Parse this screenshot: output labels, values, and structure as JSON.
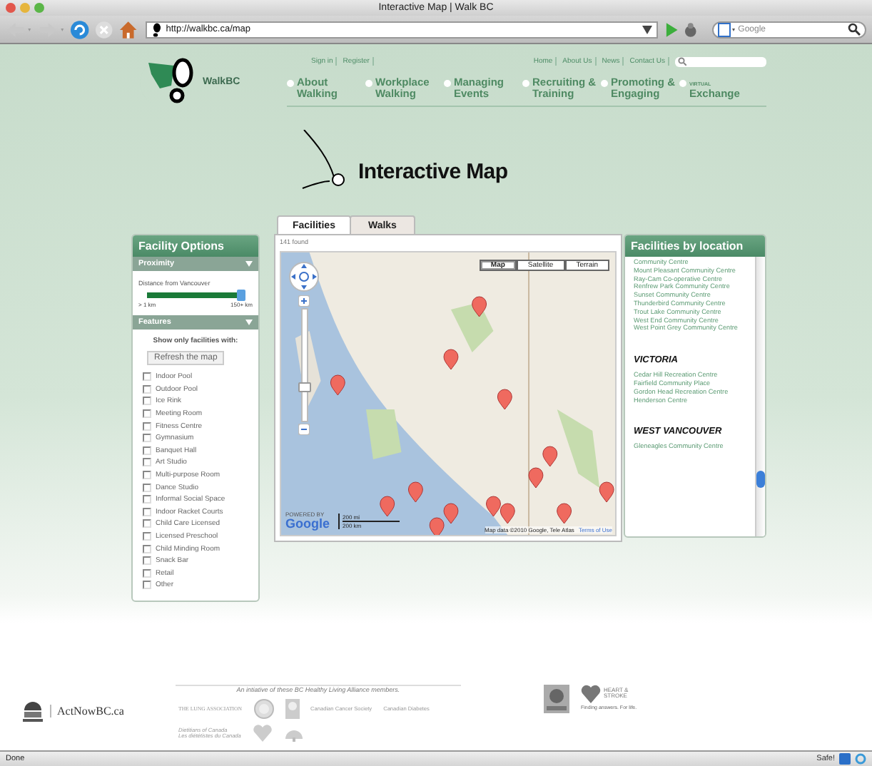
{
  "browser": {
    "title": "Interactive Map | Walk BC",
    "url": "http://walkbc.ca/map",
    "search_placeholder": "Google",
    "status": "Done",
    "safe_label": "Safe!"
  },
  "header": {
    "logo_text": "WalkBC",
    "account_links": [
      "Sign in",
      "Register"
    ],
    "util_links": [
      "Home",
      "About Us",
      "News",
      "Contact Us"
    ],
    "nav": [
      {
        "label": "About Walking"
      },
      {
        "label": "Workplace Walking"
      },
      {
        "label": "Managing Events"
      },
      {
        "label": "Recruiting & Training"
      },
      {
        "label": "Promoting & Engaging"
      },
      {
        "label": "Exchange",
        "tag": "VIRTUAL"
      }
    ],
    "page_title": "Interactive Map"
  },
  "facility_options": {
    "title": "Facility Options",
    "proximity": {
      "heading": "Proximity",
      "expanded": true,
      "label": "Distance from Vancouver",
      "level": 0.97,
      "min": "> 1 km",
      "max": "150+ km"
    },
    "features": {
      "heading": "Features",
      "expanded": true,
      "intro": "Show only facilities with:",
      "button": "Refresh the map",
      "items": [
        {
          "label": "Indoor Pool",
          "checked": false
        },
        {
          "label": "Outdoor Pool",
          "checked": false
        },
        {
          "label": "Ice Rink",
          "checked": false
        },
        {
          "label": "Meeting Room",
          "checked": false
        },
        {
          "label": "Fitness Centre",
          "checked": false
        },
        {
          "label": "Gymnasium",
          "checked": false
        },
        {
          "label": "Banquet Hall",
          "checked": false
        },
        {
          "label": "Art Studio",
          "checked": false
        },
        {
          "label": "Multi-purpose Room",
          "checked": false
        },
        {
          "label": "Dance Studio",
          "checked": false
        },
        {
          "label": "Informal Social Space",
          "checked": false
        },
        {
          "label": "Indoor Racket Courts",
          "checked": false
        },
        {
          "label": "Child Care Licensed",
          "checked": false
        },
        {
          "label": "Licensed Preschool",
          "checked": false
        },
        {
          "label": "Child Minding Room",
          "checked": false
        },
        {
          "label": "Snack Bar",
          "checked": false
        },
        {
          "label": "Retail",
          "checked": false
        },
        {
          "label": "Other",
          "checked": false
        }
      ]
    }
  },
  "tabs": [
    {
      "label": "Facilities",
      "selected": true
    },
    {
      "label": "Walks",
      "selected": false
    }
  ],
  "found": "141 found",
  "map": {
    "kind": "picture",
    "types": [
      {
        "label": "Map",
        "selected": true
      },
      {
        "label": "Satellite",
        "selected": false
      },
      {
        "label": "Terrain",
        "selected": false
      }
    ],
    "zoom": {
      "level": 0.3
    },
    "powered": "POWERED BY",
    "google": "Google",
    "scale": [
      "200 mi",
      "200 km"
    ],
    "attribution": "Map data ©2010 Google, Tele Atlas",
    "terms": "Terms of Use"
  },
  "locations": {
    "title": "Facilities by location",
    "items": [
      {
        "kind": "entry",
        "label": "Community Centre"
      },
      {
        "kind": "entry",
        "label": "Mount Pleasant Community Centre"
      },
      {
        "kind": "entry",
        "label": "Ray-Cam Co-operative Centre"
      },
      {
        "kind": "entry",
        "label": "Renfrew Park Community Centre"
      },
      {
        "kind": "entry",
        "label": "Sunset Community Centre"
      },
      {
        "kind": "entry",
        "label": "Thunderbird Community Centre"
      },
      {
        "kind": "entry",
        "label": "Trout Lake Community Centre"
      },
      {
        "kind": "entry",
        "label": "West End Community Centre"
      },
      {
        "kind": "entry",
        "label": "West Point Grey Community Centre"
      },
      {
        "kind": "city",
        "label": "VICTORIA"
      },
      {
        "kind": "entry",
        "label": "Cedar Hill Recreation Centre"
      },
      {
        "kind": "entry",
        "label": "Fairfield Community Place"
      },
      {
        "kind": "entry",
        "label": "Gordon Head Recreation Centre"
      },
      {
        "kind": "entry",
        "label": "Henderson Centre"
      },
      {
        "kind": "city",
        "label": "WEST VANCOUVER"
      },
      {
        "kind": "entry",
        "label": "Gleneagles Community Centre"
      }
    ]
  },
  "footer": {
    "actnow": "ActNowBC.ca",
    "initiative": "An intiative of these BC Healthy Living Alliance members.",
    "lung": "THE LUNG ASSOCIATION",
    "cancer": "Canadian Cancer Society",
    "diabetes": "Canadian Diabetes",
    "dietitians": [
      "Dietitians of Canada",
      "Les diététistes du Canada"
    ],
    "heart": "HEART & STROKE",
    "heart_tagline": "Finding answers. For life."
  }
}
